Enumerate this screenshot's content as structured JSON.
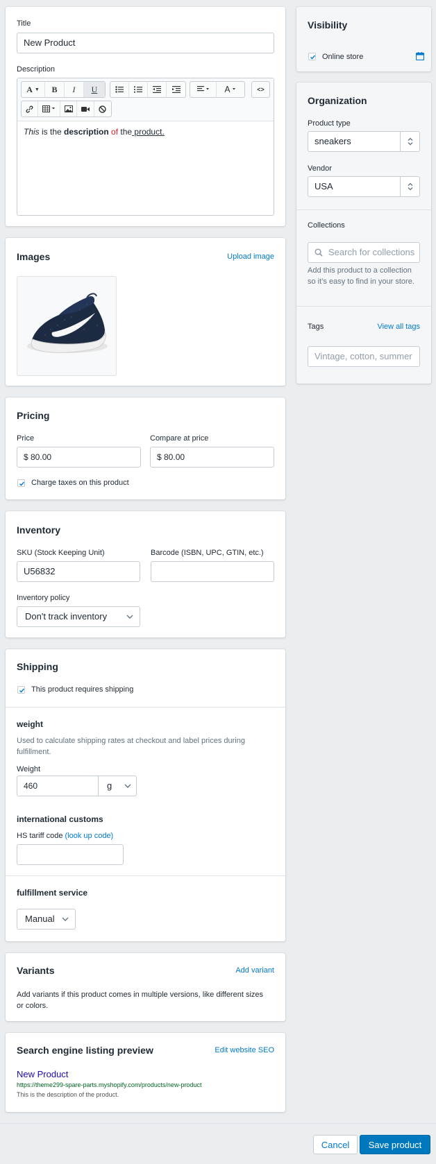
{
  "product": {
    "title_label": "Title",
    "title_value": "New Product",
    "description_label": "Description",
    "editor": {
      "w_this": "This",
      "w_is_the": " is the ",
      "w_description": "description",
      "w_of": " of",
      "w_the": " the",
      "w_product": " product."
    }
  },
  "toolbar": {
    "font": "A",
    "bold": "B",
    "italic": "I",
    "underline": "U",
    "code": "<>"
  },
  "images": {
    "title": "Images",
    "upload_link": "Upload image",
    "thumb_icon": "sneaker-image"
  },
  "pricing": {
    "title": "Pricing",
    "price_label": "Price",
    "price_value": "$ 80.00",
    "compare_label": "Compare at price",
    "compare_value": "$ 80.00",
    "taxes_label": "Charge taxes on this product"
  },
  "inventory": {
    "title": "Inventory",
    "sku_label": "SKU (Stock Keeping Unit)",
    "sku_value": "U56832",
    "barcode_label": "Barcode (ISBN, UPC, GTIN, etc.)",
    "barcode_value": "",
    "policy_label": "Inventory policy",
    "policy_value": "Don't track inventory"
  },
  "shipping": {
    "title": "Shipping",
    "requires_label": "This product requires shipping",
    "weight_heading": "weight",
    "weight_help": "Used to calculate shipping rates at checkout and label prices during fulfillment.",
    "weight_label": "Weight",
    "weight_value": "460",
    "weight_unit": "g",
    "customs_heading": "international customs",
    "hs_label": "HS tariff code",
    "hs_link": "(look up code)",
    "fulfillment_heading": "fulfillment service",
    "fulfillment_value": "Manual"
  },
  "variants": {
    "title": "Variants",
    "add_link": "Add variant",
    "help": "Add variants if this product comes in multiple versions, like different sizes or colors."
  },
  "seo": {
    "title": "Search engine listing preview",
    "edit_link": "Edit website SEO",
    "preview_title": "New Product",
    "preview_url": "https://theme299-spare-parts.myshopify.com/products/new-product",
    "preview_desc": "This is the description of the product."
  },
  "visibility": {
    "title": "Visibility",
    "online_store": "Online store"
  },
  "organization": {
    "title": "Organization",
    "type_label": "Product type",
    "type_value": "sneakers",
    "vendor_label": "Vendor",
    "vendor_value": "USA"
  },
  "collections": {
    "title": "Collections",
    "placeholder": "Search for collections",
    "help": "Add this product to a collection so it’s easy to find in your store."
  },
  "tags": {
    "title": "Tags",
    "view_all": "View all tags",
    "placeholder": "Vintage, cotton, summer"
  },
  "footer": {
    "cancel": "Cancel",
    "save": "Save product"
  },
  "colors": {
    "accent": "#007ace",
    "save_bg": "#0078bd",
    "url_green": "#006621",
    "seo_title": "#1a0dab",
    "red": "#e02020"
  }
}
